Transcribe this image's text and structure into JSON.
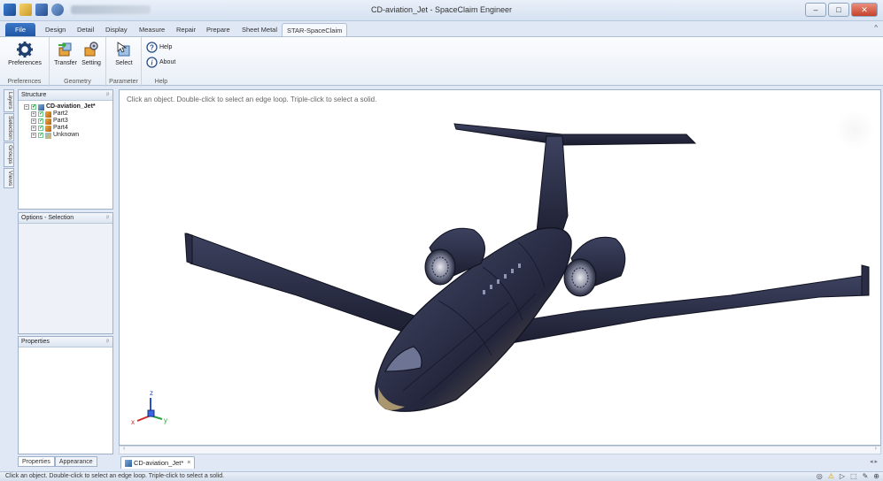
{
  "window": {
    "title": "CD-aviation_Jet - SpaceClaim Engineer",
    "min": "–",
    "max": "□",
    "close": "✕"
  },
  "ribbon": {
    "tabs": [
      "File",
      "Design",
      "Detail",
      "Display",
      "Measure",
      "Repair",
      "Prepare",
      "Sheet Metal",
      "STAR-SpaceClaim"
    ],
    "active_tab": "STAR-SpaceClaim",
    "collapse_caret": "^",
    "groups": {
      "preferences": {
        "label": "Preferences",
        "button": "Preferences"
      },
      "geometry": {
        "label": "Geometry",
        "transfer": "Transfer",
        "setting": "Setting"
      },
      "parameter": {
        "label": "Parameter",
        "select": "Select"
      },
      "help": {
        "label": "Help",
        "help": "Help",
        "about": "About"
      }
    }
  },
  "side_tabs": [
    "Layers",
    "Selection",
    "Groups",
    "Views"
  ],
  "structure": {
    "title": "Structure",
    "root": "CD-aviation_Jet*",
    "items": [
      "Part2",
      "Part3",
      "Part4",
      "Unknown"
    ]
  },
  "options_panel": {
    "title": "Options - Selection"
  },
  "properties_panel": {
    "title": "Properties"
  },
  "bottom_tabs": [
    "Properties",
    "Appearance"
  ],
  "viewport": {
    "hint": "Click an object. Double-click to select an edge loop. Triple-click to select a solid.",
    "axis": {
      "x": "x",
      "y": "y",
      "z": "z"
    }
  },
  "document_tab": {
    "label": "CD-aviation_Jet*",
    "close": "×"
  },
  "status": {
    "text": "Click an object. Double-click to select an edge loop. Triple-click to select a solid."
  },
  "colors": {
    "accent": "#1f56a4",
    "aircraft_body": "#2b2f4a",
    "aircraft_highlight": "#c9b27a"
  }
}
